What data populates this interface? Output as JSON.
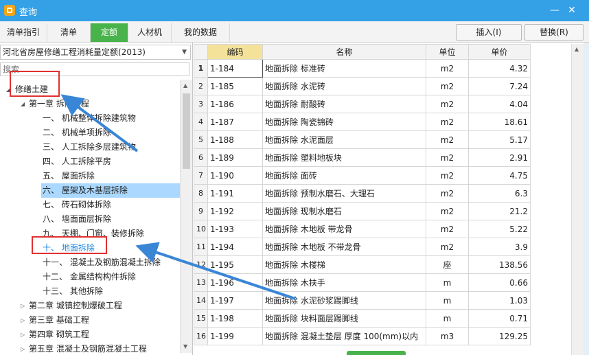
{
  "window": {
    "title": "查询",
    "minimize": "—",
    "close": "✕"
  },
  "tabs": [
    {
      "label": "清单指引"
    },
    {
      "label": "清单"
    },
    {
      "label": "定额",
      "active": true
    },
    {
      "label": "人材机"
    },
    {
      "label": "我的数据"
    }
  ],
  "toolbar": {
    "insert_label": "插入(I)",
    "replace_label": "替换(R)"
  },
  "left_panel": {
    "library": "河北省房屋修缮工程消耗量定额(2013)",
    "search_placeholder": "搜索",
    "tree": {
      "root": "修缮土建",
      "chapter1": "第一章  拆除工程",
      "sections": [
        "一、  机械整体拆除建筑物",
        "二、  机械单项拆除",
        "三、  人工拆除多层建筑物",
        "四、  人工拆除平房",
        "五、  屋面拆除",
        "六、  屋架及木基层拆除",
        "七、  砖石砌体拆除",
        "八、  墙面面层拆除",
        "九、  天棚、门窗、装修拆除",
        "十、  地面拆除",
        "十一、  混凝土及钢筋混凝土拆除",
        "十二、  金属结构构件拆除",
        "十三、  其他拆除"
      ],
      "chapters": [
        "第二章  城镇控制爆破工程",
        "第三章  基础工程",
        "第四章  砌筑工程",
        "第五章  混凝土及钢筋混凝土工程"
      ]
    }
  },
  "grid": {
    "headers": {
      "code": "编码",
      "name": "名称",
      "unit": "单位",
      "price": "单价"
    },
    "rows": [
      {
        "n": "1",
        "code": "1-184",
        "name": "地面拆除 标准砖",
        "unit": "m2",
        "price": "4.32"
      },
      {
        "n": "2",
        "code": "1-185",
        "name": "地面拆除 水泥砖",
        "unit": "m2",
        "price": "7.24"
      },
      {
        "n": "3",
        "code": "1-186",
        "name": "地面拆除 耐酸砖",
        "unit": "m2",
        "price": "4.04"
      },
      {
        "n": "4",
        "code": "1-187",
        "name": "地面拆除 陶瓷锦砖",
        "unit": "m2",
        "price": "18.61"
      },
      {
        "n": "5",
        "code": "1-188",
        "name": "地面拆除 水泥面层",
        "unit": "m2",
        "price": "5.17"
      },
      {
        "n": "6",
        "code": "1-189",
        "name": "地面拆除 塑料地板块",
        "unit": "m2",
        "price": "2.91"
      },
      {
        "n": "7",
        "code": "1-190",
        "name": "地面拆除 面砖",
        "unit": "m2",
        "price": "4.75"
      },
      {
        "n": "8",
        "code": "1-191",
        "name": "地面拆除 预制水磨石、大理石",
        "unit": "m2",
        "price": "6.3"
      },
      {
        "n": "9",
        "code": "1-192",
        "name": "地面拆除 现制水磨石",
        "unit": "m2",
        "price": "21.2"
      },
      {
        "n": "10",
        "code": "1-193",
        "name": "地面拆除 木地板 带龙骨",
        "unit": "m2",
        "price": "5.22"
      },
      {
        "n": "11",
        "code": "1-194",
        "name": "地面拆除 木地板 不带龙骨",
        "unit": "m2",
        "price": "3.9"
      },
      {
        "n": "12",
        "code": "1-195",
        "name": "地面拆除 木楼梯",
        "unit": "座",
        "price": "138.56"
      },
      {
        "n": "13",
        "code": "1-196",
        "name": "地面拆除 木扶手",
        "unit": "m",
        "price": "0.66"
      },
      {
        "n": "14",
        "code": "1-197",
        "name": "地面拆除 水泥砂浆踢脚线",
        "unit": "m",
        "price": "1.03"
      },
      {
        "n": "15",
        "code": "1-198",
        "name": "地面拆除 块料面层踢脚线",
        "unit": "m",
        "price": "0.71"
      },
      {
        "n": "16",
        "code": "1-199",
        "name": "地面拆除 混凝土垫层 厚度 100(mm)以内",
        "unit": "m3",
        "price": "129.25"
      }
    ]
  },
  "colors": {
    "titlebar": "#34a0e6",
    "active_tab": "#49b34b",
    "selected_node": "#aad8ff",
    "annotation_box": "#e03030",
    "annotation_arrow": "#3a86d6"
  }
}
